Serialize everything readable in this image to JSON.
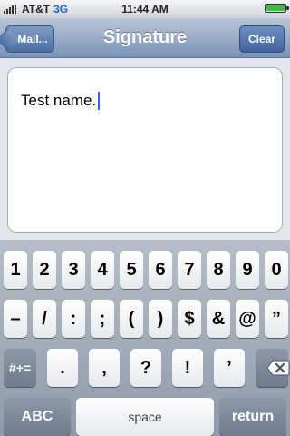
{
  "status_bar": {
    "carrier": "AT&T",
    "network": "3G",
    "time": "11:44 AM",
    "battery_level": 0.95
  },
  "nav_bar": {
    "title": "Signature",
    "back_label": "Mail...",
    "clear_label": "Clear"
  },
  "content": {
    "text": "Test name."
  },
  "keyboard": {
    "row1": [
      "1",
      "2",
      "3",
      "4",
      "5",
      "6",
      "7",
      "8",
      "9",
      "0"
    ],
    "row2": [
      "–",
      "/",
      ":",
      ";",
      "(",
      ")",
      "$",
      "&",
      "@",
      "”"
    ],
    "row3": [
      "#+=",
      ".",
      ",",
      "?",
      "!",
      "’"
    ],
    "row4": [
      "ABC",
      "space",
      "return"
    ],
    "icons": {
      "delete": "delete-icon"
    }
  }
}
